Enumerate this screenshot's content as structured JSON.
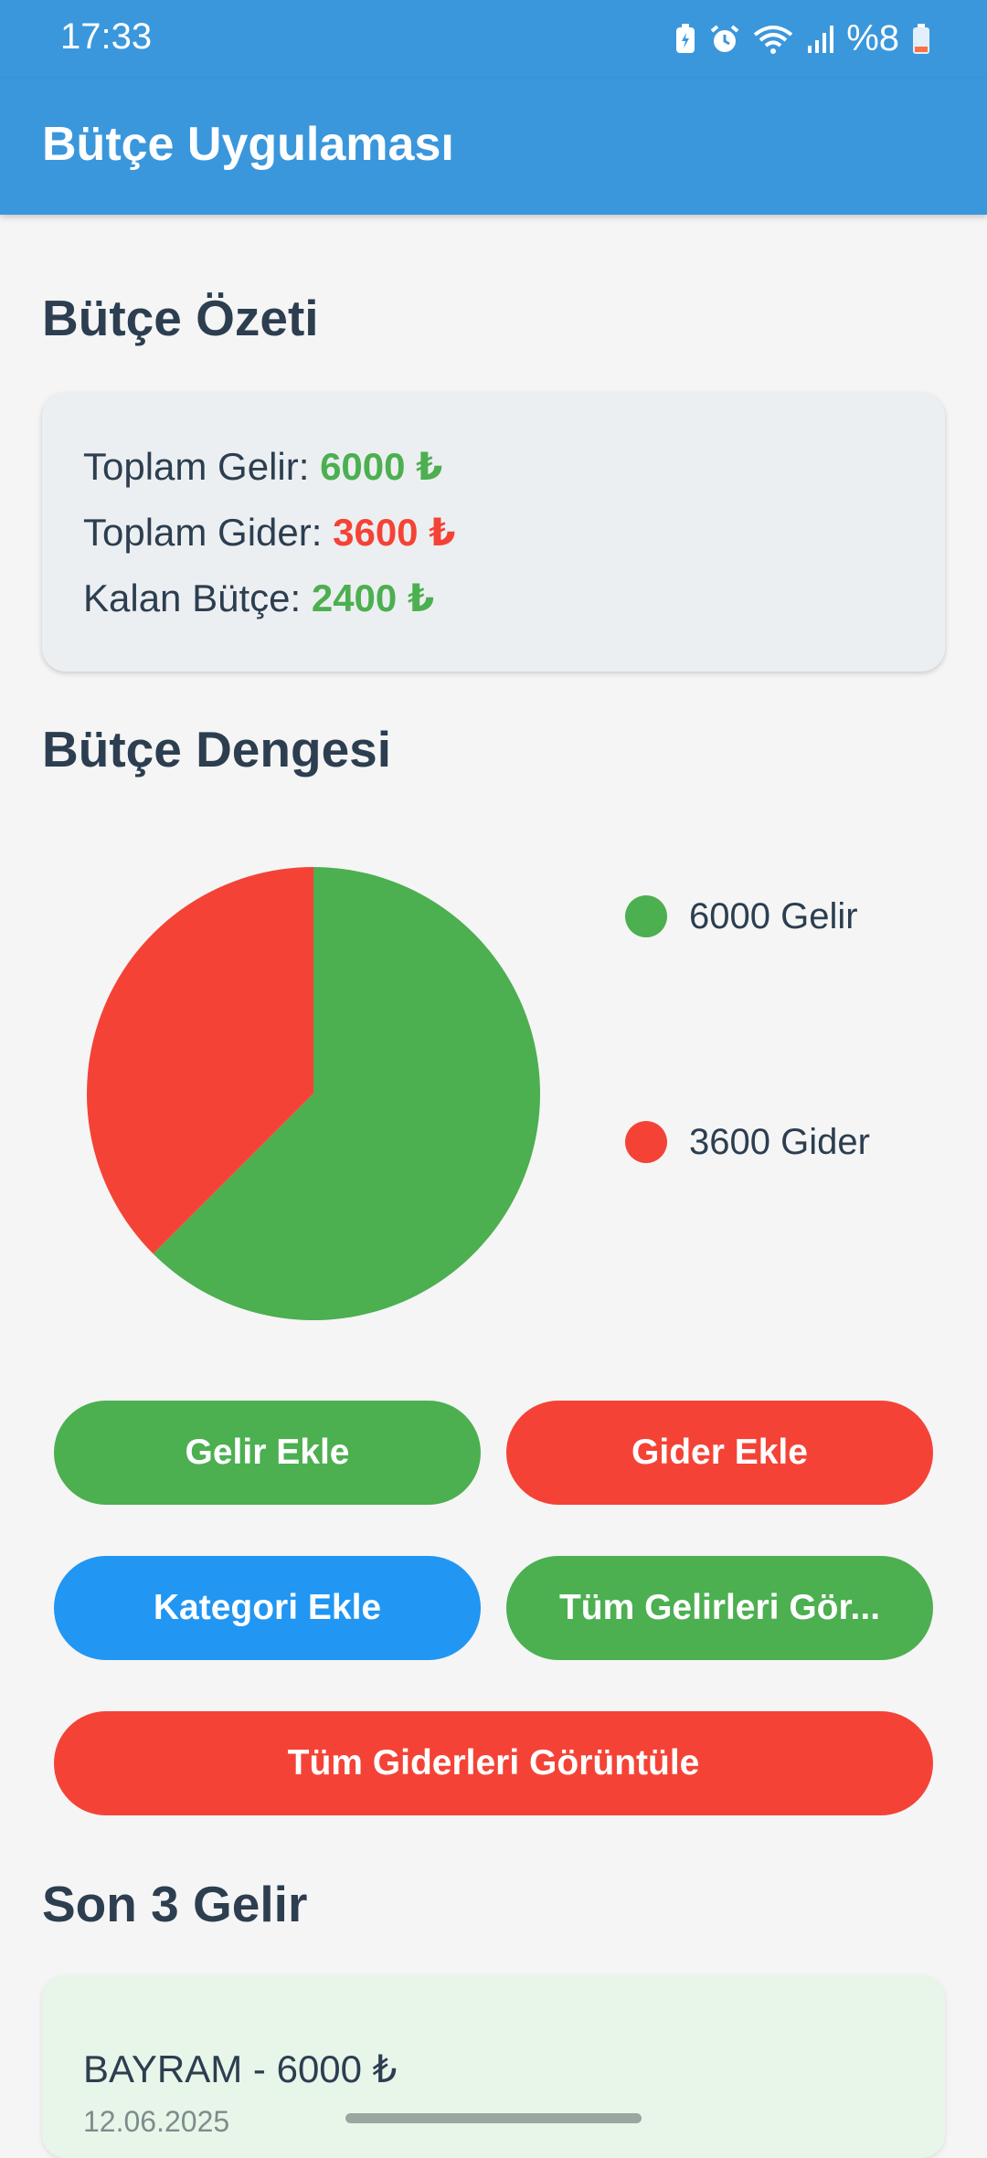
{
  "status_bar": {
    "time": "17:33",
    "battery_text": "%8",
    "icons": [
      "battery-saver-icon",
      "alarm-icon",
      "wifi-icon",
      "signal-icon",
      "battery-icon"
    ]
  },
  "app_bar": {
    "title": "Bütçe Uygulaması",
    "color": "#3a97dc"
  },
  "summary": {
    "title": "Bütçe Özeti",
    "income_label": "Toplam Gelir:",
    "income_value": "6000 ₺",
    "expense_label": "Toplam Gider:",
    "expense_value": "3600 ₺",
    "remaining_label": "Kalan Bütçe:",
    "remaining_value": "2400 ₺"
  },
  "balance": {
    "title": "Bütçe Dengesi"
  },
  "chart_data": {
    "type": "pie",
    "slices": [
      {
        "label": "6000 Gelir",
        "name": "Gelir",
        "value": 6000,
        "color": "#4caf50"
      },
      {
        "label": "3600 Gider",
        "name": "Gider",
        "value": 3600,
        "color": "#f44336"
      }
    ],
    "legend": "right"
  },
  "buttons": {
    "add_income": "Gelir Ekle",
    "add_expense": "Gider Ekle",
    "add_category": "Kategori Ekle",
    "view_all_income": "Tüm Gelirleri Gör...",
    "view_all_expenses": "Tüm Giderleri Görüntüle"
  },
  "colors": {
    "green": "#4caf50",
    "red": "#f44336",
    "blue": "#2196f3",
    "text": "#2c3e50"
  },
  "recent_income": {
    "title": "Son 3 Gelir",
    "items": [
      {
        "title": "BAYRAM - 6000 ₺",
        "date": "12.06.2025"
      }
    ]
  }
}
